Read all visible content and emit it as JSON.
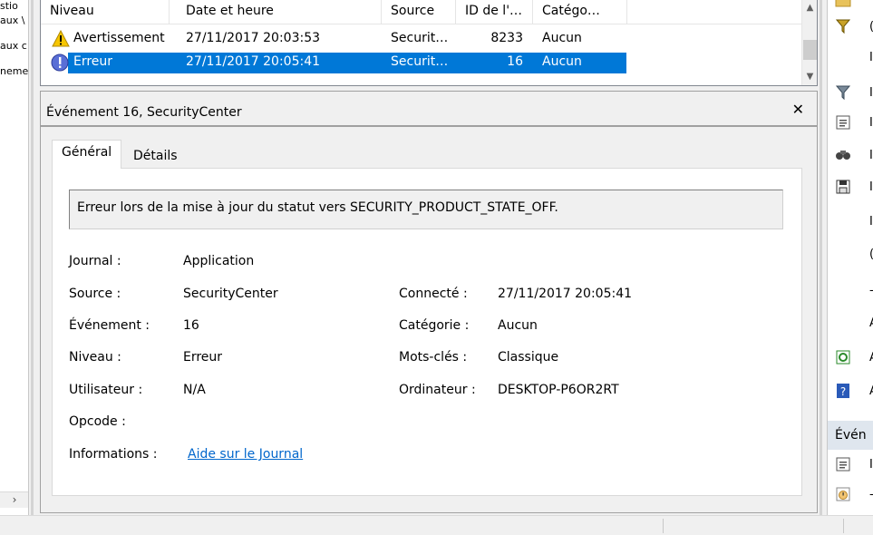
{
  "tree": {
    "fragments": [
      "stio",
      "aux \\",
      "aux c",
      "neme"
    ],
    "scroll_arrow": "›"
  },
  "event_list": {
    "columns": [
      "Niveau",
      "Date et heure",
      "Source",
      "ID de l'…",
      "Catégo…"
    ],
    "rows": [
      {
        "level": "Avertissement",
        "level_icon": "warning-icon",
        "datetime": "27/11/2017 20:03:53",
        "source": "Securit…",
        "id": "8233",
        "category": "Aucun",
        "selected": false
      },
      {
        "level": "Erreur",
        "level_icon": "error-icon",
        "datetime": "27/11/2017 20:05:41",
        "source": "Securit…",
        "id": "16",
        "category": "Aucun",
        "selected": true
      }
    ]
  },
  "detail": {
    "title": "Événement 16, SecurityCenter",
    "tabs": [
      "Général",
      "Détails"
    ],
    "message": "Erreur lors de la mise à jour du statut  vers SECURITY_PRODUCT_STATE_OFF.",
    "fields_left": [
      {
        "label": "Journal :",
        "value": "Application"
      },
      {
        "label": "Source :",
        "value": "SecurityCenter"
      },
      {
        "label": "Événement :",
        "value": "16"
      },
      {
        "label": "Niveau :",
        "value": "Erreur"
      },
      {
        "label": "Utilisateur :",
        "value": "N/A"
      },
      {
        "label": "Opcode :",
        "value": ""
      },
      {
        "label": "Informations :",
        "value": "Aide sur le Journal"
      }
    ],
    "fields_right": [
      {
        "label": "Connecté :",
        "value": "27/11/2017 20:05:41"
      },
      {
        "label": "Catégorie :",
        "value": "Aucun"
      },
      {
        "label": "Mots-clés :",
        "value": "Classique"
      },
      {
        "label": "Ordinateur :",
        "value": "DESKTOP-P6OR2RT"
      }
    ]
  },
  "actions": {
    "section_label": "Évén",
    "items": [
      {
        "icon": "filter-icon",
        "text": "("
      },
      {
        "icon": "",
        "text": "I"
      },
      {
        "icon": "filter-clear-icon",
        "text": "I"
      },
      {
        "icon": "properties-icon",
        "text": "I"
      },
      {
        "icon": "find-icon",
        "text": "I"
      },
      {
        "icon": "save-icon",
        "text": "I"
      },
      {
        "icon": "",
        "text": "I"
      },
      {
        "icon": "",
        "text": "("
      },
      {
        "icon": "",
        "text": "-"
      },
      {
        "icon": "",
        "text": "A"
      },
      {
        "icon": "refresh-icon",
        "text": "A"
      },
      {
        "icon": "help-icon",
        "text": "A"
      },
      {
        "icon": "event-properties-icon",
        "text": "I"
      },
      {
        "icon": "task-icon",
        "text": "-"
      }
    ]
  },
  "colors": {
    "selection": "#0078d7",
    "link": "#0066cc",
    "section_bg": "#dfe6ee"
  }
}
